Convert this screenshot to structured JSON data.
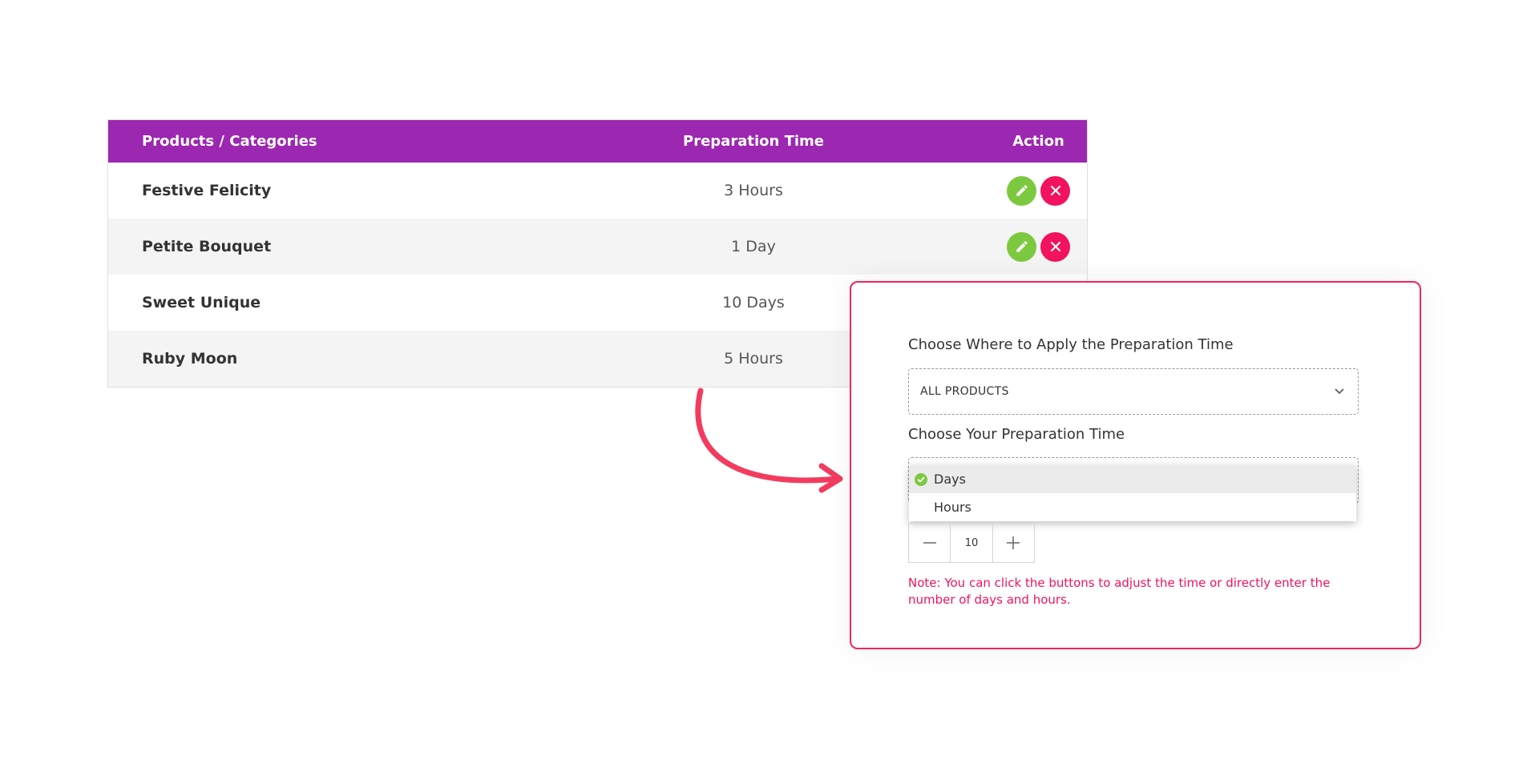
{
  "table": {
    "headers": {
      "name": "Products / Categories",
      "time": "Preparation Time",
      "action": "Action"
    },
    "rows": [
      {
        "name": "Festive Felicity",
        "time": "3 Hours"
      },
      {
        "name": "Petite Bouquet",
        "time": "1 Day"
      },
      {
        "name": "Sweet Unique",
        "time": "10 Days"
      },
      {
        "name": "Ruby Moon",
        "time": "5 Hours"
      }
    ]
  },
  "modal": {
    "apply_label": "Choose Where to Apply the Preparation Time",
    "apply_value": "ALL PRODUCTS",
    "time_label": "Choose Your Preparation Time",
    "unit_options": [
      "Days",
      "Hours"
    ],
    "selected_unit": "Days",
    "stepper_value": "10",
    "note": "Note: You can click the buttons to adjust the time or directly enter the number of days and hours."
  },
  "colors": {
    "header_bg": "#9c27b0",
    "edit_button": "#7cc940",
    "delete_button": "#f2125e",
    "accent": "#f2245e",
    "arrow": "#f23c5f"
  },
  "icons": {
    "edit": "pencil-icon",
    "delete": "close-icon",
    "dropdown": "chevron-down-icon",
    "selected": "check-circle-icon",
    "decrease": "minus-icon",
    "increase": "plus-icon",
    "pointer": "curved-arrow-icon"
  }
}
